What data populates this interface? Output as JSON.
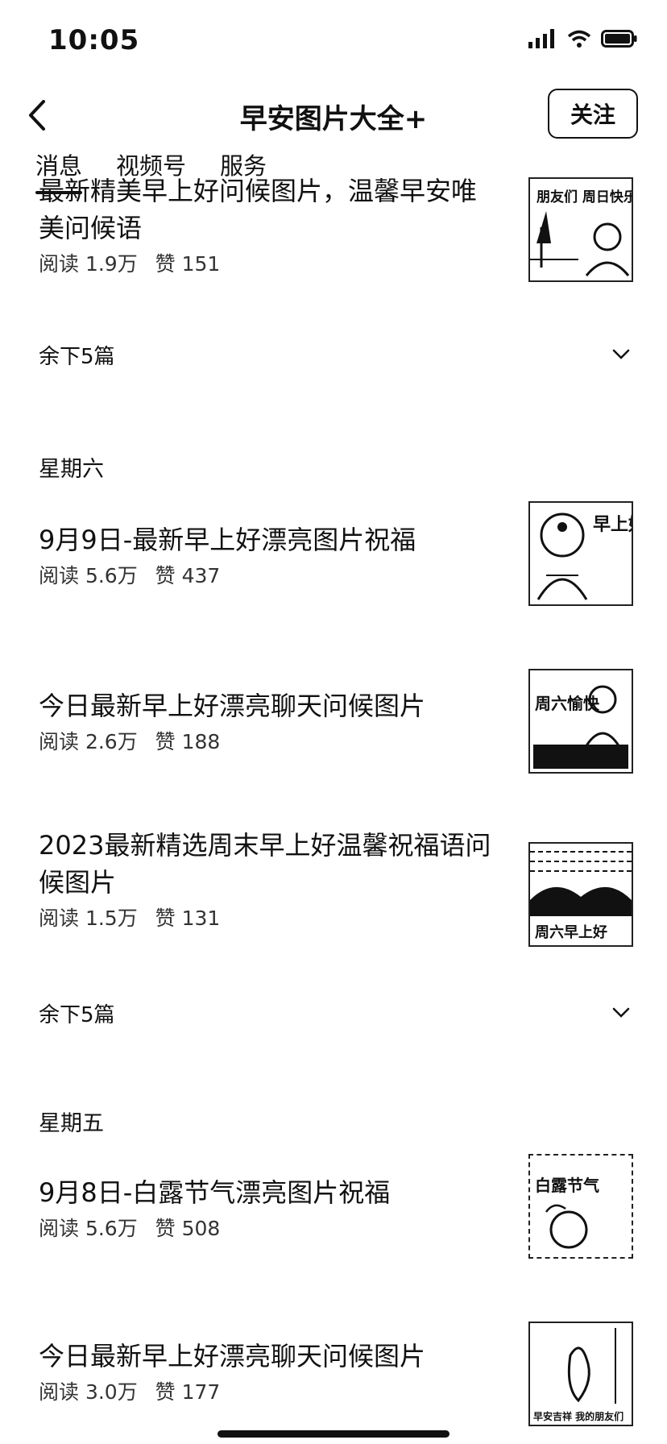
{
  "status": {
    "time": "10:05"
  },
  "header": {
    "title": "早安图片大全+",
    "follow_label": "关注"
  },
  "tabs": [
    "消息",
    "视频号",
    "服务"
  ],
  "groups": [
    {
      "articles": [
        {
          "title": "最新精美早上好问候图片，温馨早安唯美问候语",
          "reads": "阅读 1.9万",
          "likes": "赞 151",
          "thumb_text": "朋友们 周日快乐"
        }
      ],
      "more_label": "余下5篇"
    },
    {
      "day": "星期六",
      "articles": [
        {
          "title": "9月9日-最新早上好漂亮图片祝福",
          "reads": "阅读 5.6万",
          "likes": "赞 437",
          "thumb_text": "早上好"
        },
        {
          "title": "今日最新早上好漂亮聊天问候图片",
          "reads": "阅读 2.6万",
          "likes": "赞 188",
          "thumb_text": "周六愉快"
        },
        {
          "title": "2023最新精选周末早上好温馨祝福语问候图片",
          "reads": "阅读 1.5万",
          "likes": "赞 131",
          "thumb_text": "周六早上好"
        }
      ],
      "more_label": "余下5篇"
    },
    {
      "day": "星期五",
      "articles": [
        {
          "title": "9月8日-白露节气漂亮图片祝福",
          "reads": "阅读 5.6万",
          "likes": "赞 508",
          "thumb_text": "白露节气"
        },
        {
          "title": "今日最新早上好漂亮聊天问候图片",
          "reads": "阅读 3.0万",
          "likes": "赞 177",
          "thumb_text": "早安吉祥 我的朋友们"
        }
      ]
    }
  ]
}
